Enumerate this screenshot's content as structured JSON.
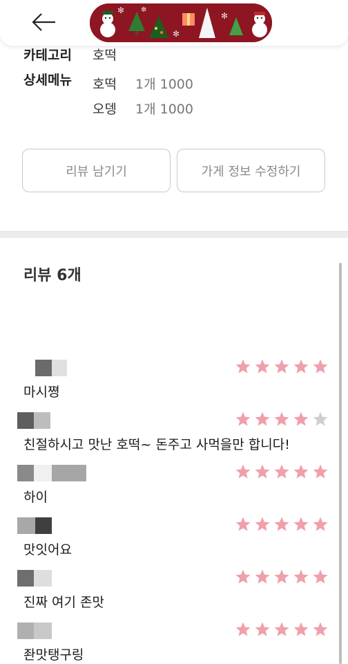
{
  "header": {
    "back_icon": "arrow-left-icon",
    "banner": "christmas-pattern-banner"
  },
  "info": {
    "category_label": "카테고리",
    "category_value": "호떡",
    "menu_label": "상세메뉴",
    "menu_items": [
      {
        "name": "호떡",
        "price": "1개 1000"
      },
      {
        "name": "오뎅",
        "price": "1개 1000"
      }
    ]
  },
  "buttons": {
    "review_label": "리뷰 남기기",
    "edit_label": "가게 정보 수정하기"
  },
  "reviews": {
    "title": "리뷰 6개",
    "star_color": "#f0a0ab",
    "star_empty_color": "#cfcfcf",
    "items": [
      {
        "text": "마시쪙",
        "rating": 5
      },
      {
        "text": "친절하시고 맛난 호떡~ 돈주고 사먹을만 합니다!",
        "rating": 4
      },
      {
        "text": "하이",
        "rating": 5
      },
      {
        "text": "맛잇어요",
        "rating": 5
      },
      {
        "text": "진짜 여기 존맛",
        "rating": 5
      },
      {
        "text": "좐맛탱구링",
        "rating": 5
      }
    ]
  }
}
